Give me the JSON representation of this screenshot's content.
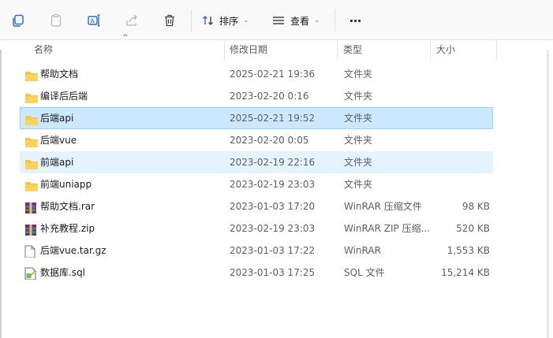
{
  "toolbar": {
    "sort_label": "排序",
    "view_label": "查看",
    "more_label": "···"
  },
  "columns": {
    "name": "名称",
    "modified": "修改日期",
    "type": "类型",
    "size": "大小"
  },
  "files": [
    {
      "name": "帮助文档",
      "modified": "2025-02-21 19:36",
      "type": "文件夹",
      "size": "",
      "icon": "folder-icon",
      "state": ""
    },
    {
      "name": "编译后后端",
      "modified": "2023-02-20 0:16",
      "type": "文件夹",
      "size": "",
      "icon": "folder-icon",
      "state": ""
    },
    {
      "name": "后端api",
      "modified": "2025-02-21 19:52",
      "type": "文件夹",
      "size": "",
      "icon": "folder-icon",
      "state": "selected"
    },
    {
      "name": "后端vue",
      "modified": "2023-02-20 0:05",
      "type": "文件夹",
      "size": "",
      "icon": "folder-icon",
      "state": ""
    },
    {
      "name": "前端api",
      "modified": "2023-02-19 22:16",
      "type": "文件夹",
      "size": "",
      "icon": "folder-icon",
      "state": "hovered"
    },
    {
      "name": "前端uniapp",
      "modified": "2023-02-19 23:03",
      "type": "文件夹",
      "size": "",
      "icon": "folder-icon",
      "state": ""
    },
    {
      "name": "帮助文档.rar",
      "modified": "2023-01-03 17:20",
      "type": "WinRAR 压缩文件",
      "size": "98 KB",
      "icon": "rar-archive-icon",
      "state": ""
    },
    {
      "name": "补充教程.zip",
      "modified": "2023-02-19 23:03",
      "type": "WinRAR ZIP 压缩...",
      "size": "520 KB",
      "icon": "zip-archive-icon",
      "state": ""
    },
    {
      "name": "后端vue.tar.gz",
      "modified": "2023-01-03 17:22",
      "type": "WinRAR",
      "size": "1,553 KB",
      "icon": "blank-file-icon",
      "state": ""
    },
    {
      "name": "数据库.sql",
      "modified": "2023-01-03 17:25",
      "type": "SQL 文件",
      "size": "15,214 KB",
      "icon": "sql-file-icon",
      "state": ""
    }
  ]
}
